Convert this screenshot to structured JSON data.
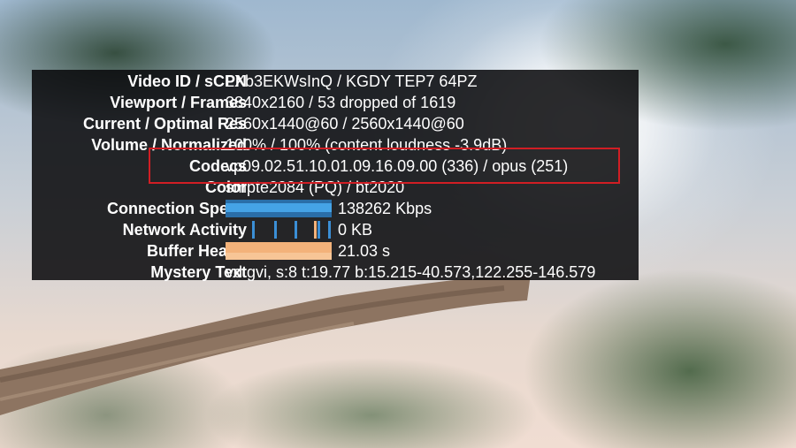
{
  "stats": {
    "rows": [
      {
        "label": "Video ID / sCPN",
        "value": "LXb3EKWsInQ / KGDY TEP7 64PZ"
      },
      {
        "label": "Viewport / Frames",
        "value": "3840x2160 / 53 dropped of 1619"
      },
      {
        "label": "Current / Optimal Res",
        "value": "2560x1440@60 / 2560x1440@60"
      },
      {
        "label": "Volume / Normalized",
        "value": "100% / 100% (content loudness -3.9dB)"
      },
      {
        "label": "Codecs",
        "value": "vp09.02.51.10.01.09.16.09.00 (336) / opus (251)"
      },
      {
        "label": "Color",
        "value": "smpte2084 (PQ) / bt2020"
      },
      {
        "label": "Connection Speed",
        "value": "138262 Kbps"
      },
      {
        "label": "Network Activity",
        "value": "0 KB"
      },
      {
        "label": "Buffer Health",
        "value": "21.03 s"
      },
      {
        "label": "Mystery Text",
        "value": "vd:gvi, s:8 t:19.77 b:15.215-40.573,122.255-146.579"
      }
    ]
  },
  "colors": {
    "panel_bg": "#08080a",
    "highlight": "#d11e24",
    "connection_graph": "#45a3e6",
    "buffer_graph": "#f3b27a"
  }
}
